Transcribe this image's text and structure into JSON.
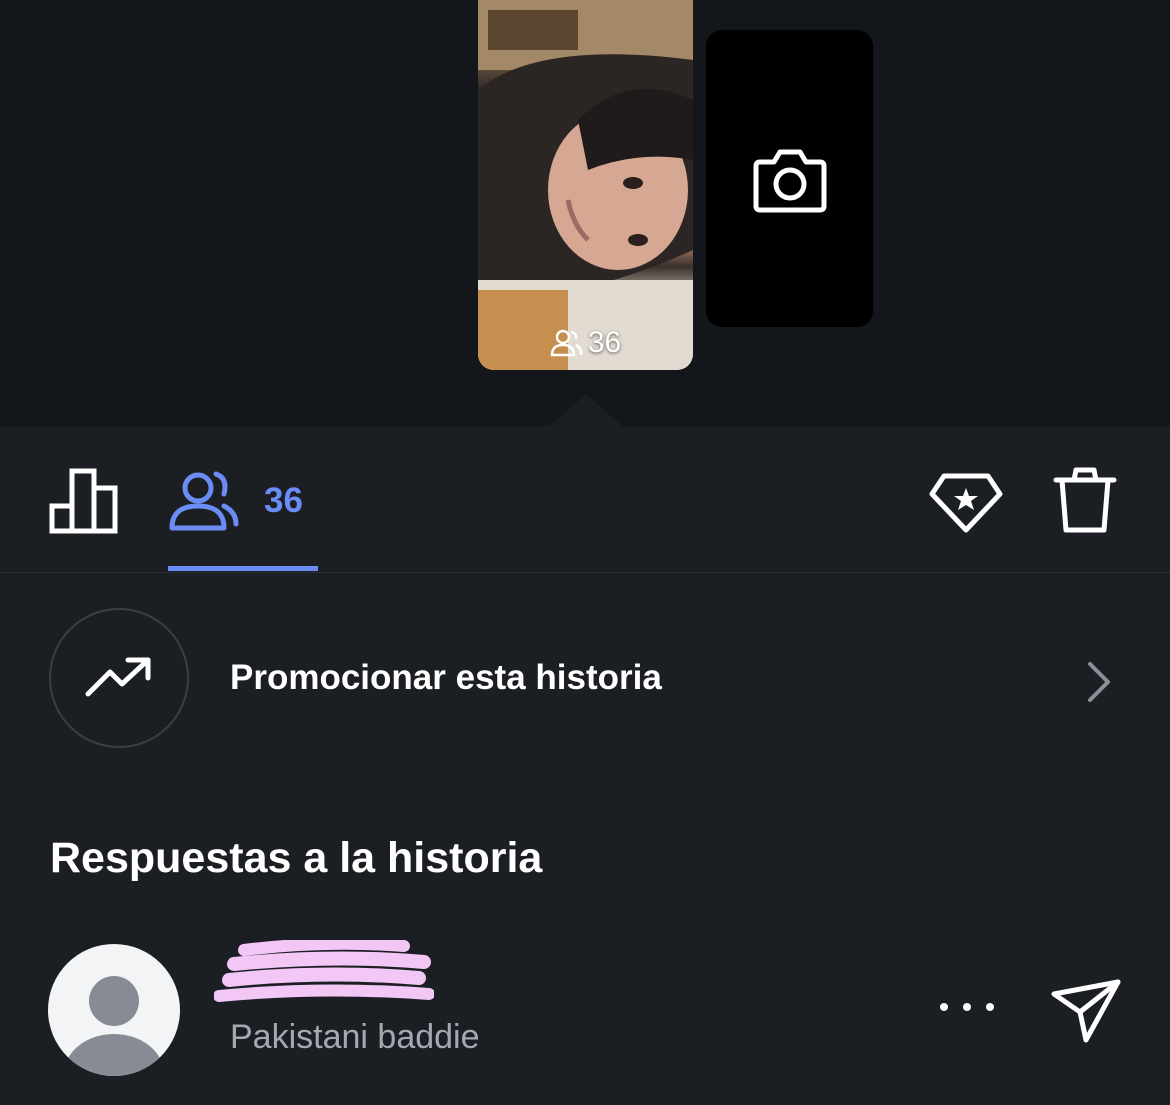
{
  "story": {
    "viewer_count": "36",
    "photo_desc": "selfie-photo"
  },
  "add_story": {
    "icon": "camera-icon"
  },
  "tabs": {
    "stats_icon": "bar-chart-icon",
    "viewers_icon": "viewers-icon",
    "viewers_count": "36",
    "promote_icon": "diamond-star-icon",
    "delete_icon": "trash-icon",
    "active_color": "#6c8cf5"
  },
  "promote": {
    "label": "Promocionar esta historia",
    "icon": "trending-up-icon",
    "chevron": "chevron-right-icon"
  },
  "replies": {
    "title": "Respuestas a la historia",
    "items": [
      {
        "subtitle": "Pakistani baddie",
        "avatar_icon": "default-avatar-icon",
        "more_icon": "more-dots-icon",
        "send_icon": "send-icon"
      }
    ]
  },
  "colors": {
    "background": "#1b1f24",
    "top_background": "#13171c",
    "redaction": "#f2c6f5"
  }
}
